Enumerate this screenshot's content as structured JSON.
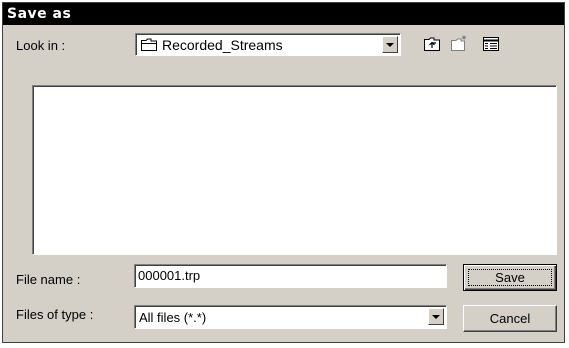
{
  "window": {
    "title": "Save as"
  },
  "look_in": {
    "label": "Look in :",
    "value": "Recorded_Streams"
  },
  "toolbar": {
    "up_icon": "up-one-level-icon",
    "new_folder_icon": "new-folder-icon",
    "view_icon": "details-view-icon"
  },
  "file_name": {
    "label": "File name :",
    "value": "000001.trp"
  },
  "file_type": {
    "label": "Files of type :",
    "value": "All files (*.*)"
  },
  "buttons": {
    "save": "Save",
    "cancel": "Cancel"
  },
  "colors": {
    "titlebar": "#000000",
    "face": "#d4d0c8"
  }
}
